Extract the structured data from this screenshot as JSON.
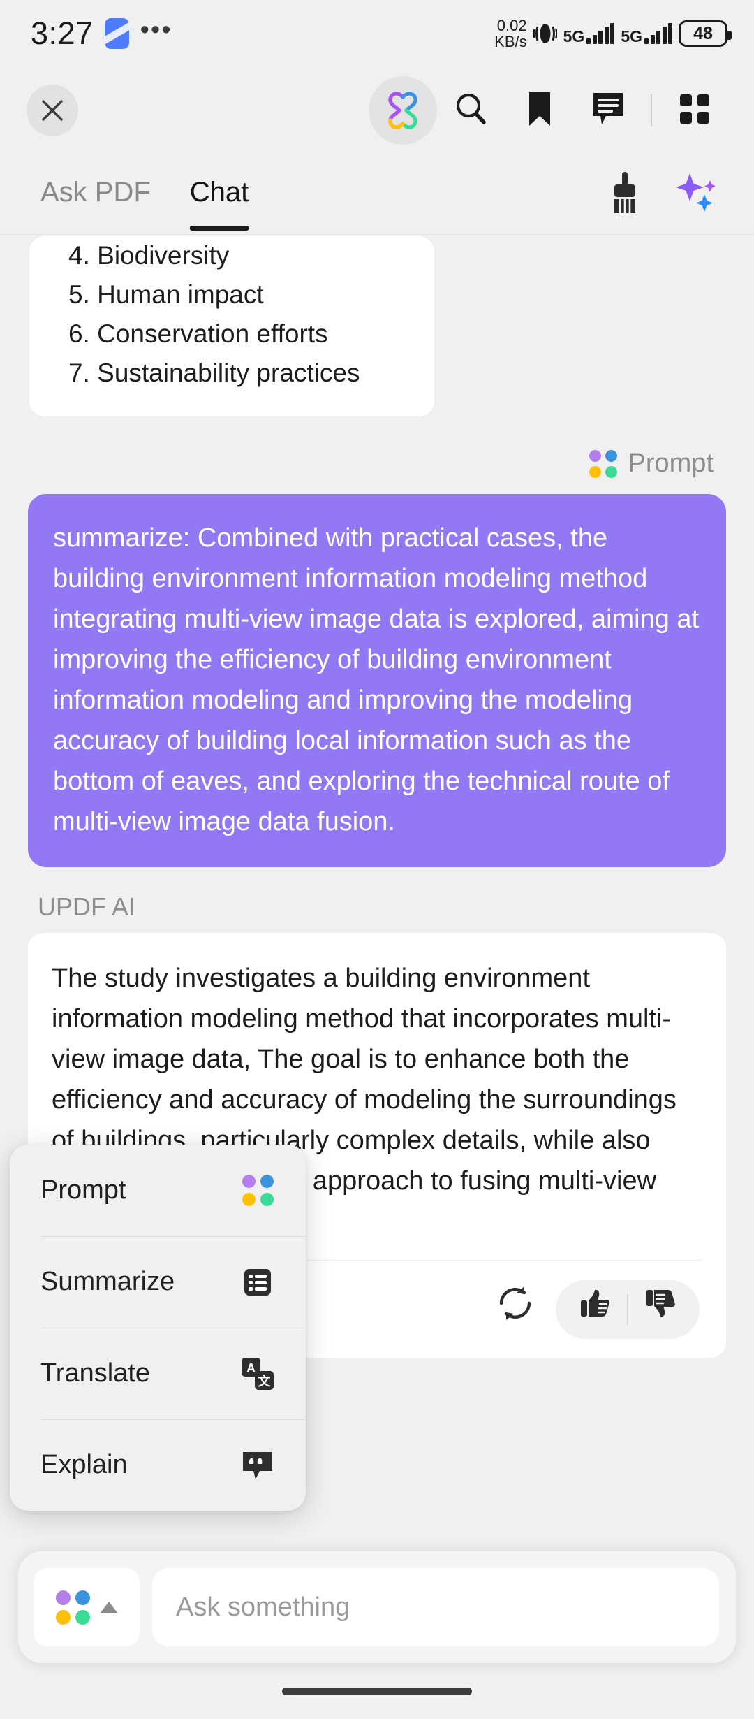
{
  "status_bar": {
    "time": "3:27",
    "app_icon": "app-badge-icon",
    "overflow": "•••",
    "network_speed": "0.02",
    "network_speed_unit": "KB/s",
    "vibrate_icon": "vibrate-icon",
    "sim1_network": "5G",
    "sim2_network": "5G",
    "battery_percent": "48"
  },
  "toolbar": {
    "close_label": "✕",
    "ai_button": "updf-ai-flower-icon",
    "search": "search-icon",
    "bookmark": "bookmark-icon",
    "comment": "comment-icon",
    "grid": "grid-menu-icon"
  },
  "tabs": {
    "items": [
      {
        "label": "Ask PDF",
        "active": false
      },
      {
        "label": "Chat",
        "active": true
      }
    ],
    "clean_icon": "brush-icon",
    "ai_icon": "sparkle-icon"
  },
  "chat": {
    "outline_card": {
      "items": [
        "4. Biodiversity",
        "5. Human impact",
        "6. Conservation efforts",
        "7. Sustainability practices"
      ]
    },
    "prompt_label": "Prompt",
    "user_message": "summarize: Combined with practical cases, the building environment information modeling method integrating multi-view image data is explored, aiming at improving the efficiency of building environment information modeling and improving the modeling accuracy of building local information such as the bottom of eaves, and exploring the technical route of multi-view image data fusion.",
    "ai_name": "UPDF AI",
    "ai_message": "The study investigates a building environment information modeling method that incorporates multi-view image data, The goal is to enhance both the efficiency and accuracy of modeling the surroundings of buildings, particularly complex details, while also identifying a technical approach to fusing multi-view image data.",
    "actions": {
      "regenerate": "refresh-icon",
      "like": "thumbs-up-icon",
      "dislike": "thumbs-down-icon"
    }
  },
  "menu": {
    "items": [
      {
        "label": "Prompt",
        "icon": "four-dot-prompt-icon"
      },
      {
        "label": "Summarize",
        "icon": "list-summarize-icon"
      },
      {
        "label": "Translate",
        "icon": "translate-icon"
      },
      {
        "label": "Explain",
        "icon": "quote-bubble-explain-icon"
      }
    ]
  },
  "input_bar": {
    "model_icon": "four-dot-prompt-icon",
    "caret": "caret-up-icon",
    "placeholder": "Ask something",
    "value": ""
  },
  "colors": {
    "accent_purple": "#9278f2",
    "dot_purple": "#b47fea",
    "dot_blue": "#3b93e0",
    "dot_yellow": "#ffc107",
    "dot_green": "#3adb96",
    "page_bg": "#f0f0f0",
    "card_bg": "#ffffff"
  }
}
